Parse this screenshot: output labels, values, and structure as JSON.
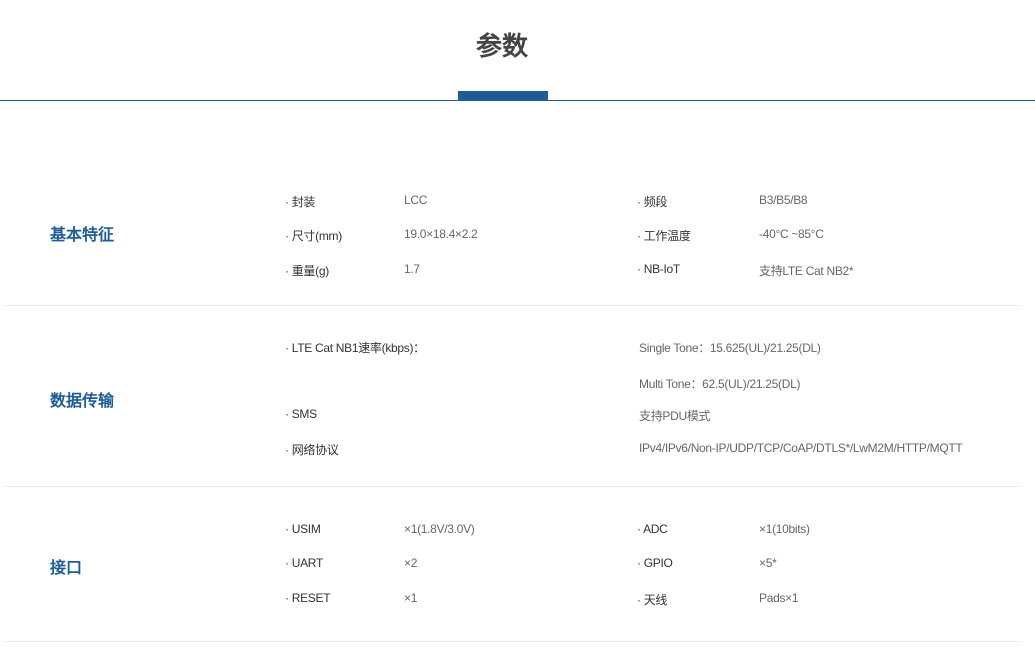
{
  "title": "参数",
  "sections": [
    {
      "label": "基本特征",
      "rows": [
        {
          "k1": "· 封装",
          "v1": "LCC",
          "k2": "· 频段",
          "v2": "B3/B5/B8"
        },
        {
          "k1": "· 尺寸(mm)",
          "v1": "19.0×18.4×2.2",
          "k2": "· 工作温度",
          "v2": "-40°C ~85°C"
        },
        {
          "k1": "· 重量(g)",
          "v1": "1.7",
          "k2": "· NB-IoT",
          "v2": "支持LTE Cat NB2*"
        }
      ]
    },
    {
      "label": "数据传输",
      "rows": [
        {
          "k": "· LTE Cat NB1速率(kbps)：",
          "v": "Single Tone：15.625(UL)/21.25(DL)"
        },
        {
          "k": "",
          "v": "Multi Tone：62.5(UL)/21.25(DL)"
        },
        {
          "k": "· SMS",
          "v": "支持PDU模式"
        },
        {
          "k": "· 网络协议",
          "v": "IPv4/IPv6/Non-IP/UDP/TCP/CoAP/DTLS*/LwM2M/HTTP/MQTT"
        }
      ]
    },
    {
      "label": "接口",
      "rows": [
        {
          "k1": "· USIM",
          "v1": "×1(1.8V/3.0V)",
          "k2": "· ADC",
          "v2": "×1(10bits)"
        },
        {
          "k1": "· UART",
          "v1": "×2",
          "k2": "· GPIO",
          "v2": "×5*"
        },
        {
          "k1": "· RESET",
          "v1": "×1",
          "k2": "· 天线",
          "v2": "Pads×1"
        }
      ]
    }
  ]
}
